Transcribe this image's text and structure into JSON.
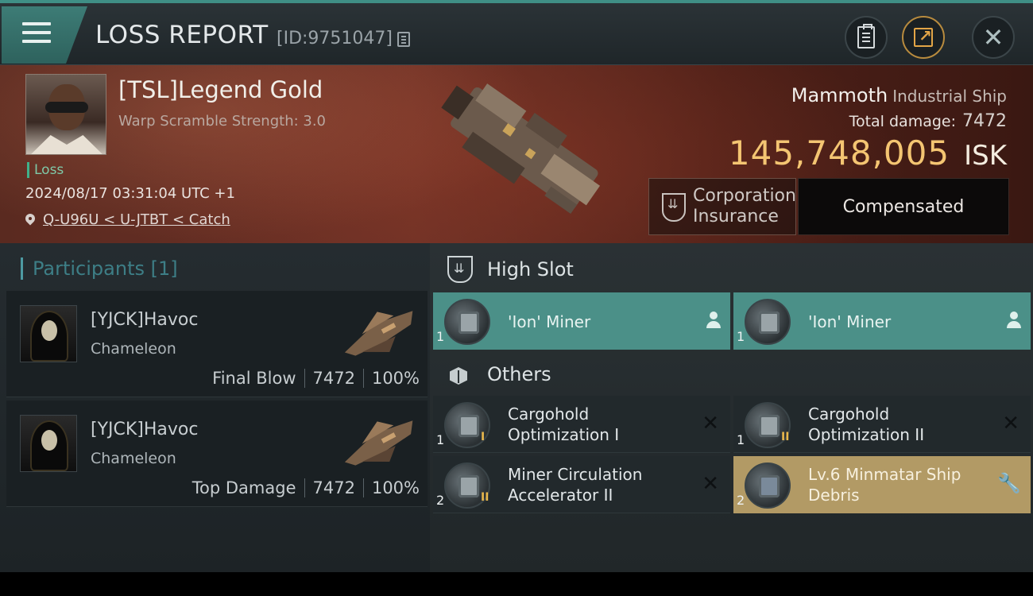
{
  "header": {
    "title": "LOSS REPORT",
    "report_id": "[ID:9751047]"
  },
  "victim": {
    "name": "[TSL]Legend Gold",
    "scramble": "Warp Scramble Strength: 3.0",
    "status": "Loss",
    "datetime": "2024/08/17 03:31:04 UTC +1",
    "location": "Q-U96U < U-JTBT < Catch"
  },
  "ship": {
    "name": "Mammoth",
    "class": "Industrial Ship",
    "total_damage_label": "Total damage:",
    "total_damage": "7472",
    "isk_value": "145,748,005",
    "isk_unit": "ISK"
  },
  "insurance": {
    "label_line1": "Corporation",
    "label_line2": "Insurance",
    "status": "Compensated"
  },
  "participants": {
    "title": "Participants [1]",
    "rows": [
      {
        "name": "[YJCK]Havoc",
        "ship": "Chameleon",
        "role": "Final Blow",
        "damage": "7472",
        "percent": "100%"
      },
      {
        "name": "[YJCK]Havoc",
        "ship": "Chameleon",
        "role": "Top Damage",
        "damage": "7472",
        "percent": "100%"
      }
    ]
  },
  "high_slot": {
    "title": "High Slot",
    "modules": [
      {
        "name": "'Ion' Miner",
        "qty": "1"
      },
      {
        "name": "'Ion' Miner",
        "qty": "1"
      }
    ]
  },
  "others": {
    "title": "Others",
    "modules": [
      {
        "line1": "Cargohold",
        "line2": "Optimization I",
        "qty": "1",
        "tier": "I"
      },
      {
        "line1": "Cargohold",
        "line2": "Optimization II",
        "qty": "1",
        "tier": "II"
      },
      {
        "line1": "Miner Circulation",
        "line2": "Accelerator II",
        "qty": "2",
        "tier": "II"
      },
      {
        "line1": "Lv.6 Minmatar Ship",
        "line2": "Debris",
        "qty": "2",
        "tier": ""
      }
    ]
  },
  "colors": {
    "accent_teal": "#4b9088",
    "isk_gold": "#f4c572",
    "debris_gold": "#b29a65",
    "loss_green": "#7fc9a8"
  },
  "icons": {
    "menu": "hamburger-icon",
    "copy": "copy-icon",
    "clipboard": "clipboard-icon",
    "share": "share-icon",
    "close": "close-icon",
    "location": "map-pin-icon",
    "insurance": "insurance-shield-icon",
    "high_slot": "high-slot-icon",
    "others": "cargo-box-icon",
    "pilot": "pilot-icon",
    "dropped": "x-destroyed-icon",
    "salvage": "wrench-icon"
  }
}
